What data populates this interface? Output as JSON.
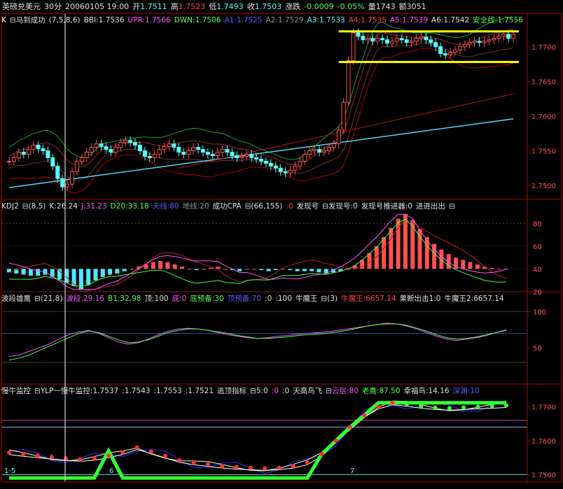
{
  "header": {
    "symbol": "英磅兑美元",
    "period": "30分",
    "datetime": "20060105 19:00",
    "open_label": "开",
    "open": "1.7511",
    "high_label": "高",
    "high": "1.7523",
    "low_label": "低",
    "low": "1.7493",
    "close_label": "收",
    "close": "1.7503",
    "change_label": "涨跌",
    "change": "-0.0009",
    "change_pct": "-0.05%",
    "volume_label": "量1743",
    "amount_label": "额3051"
  },
  "panel1": {
    "k": "K",
    "name": "马到成功",
    "params": "(7,5,8,6)",
    "bbi": "BBI:1.7536",
    "upr": "UPR:1.7566",
    "dwn": "DWN:1.7506",
    "a1": "A1:1.7525",
    "a2": "A2:1.7529",
    "a3": "A3:1.7533",
    "a4": "A4:1.7535",
    "a5": "A5:1.7539",
    "a6": "A6:1.7542",
    "safe": "安全线:1.7556",
    "ticks": [
      "1.7700",
      "1.7650",
      "1.7600",
      "1.7550",
      "1.7500"
    ]
  },
  "panel2": {
    "name": "KDJ2",
    "params": "(8,5)",
    "k": "K:26.24",
    "j": "J:31.23",
    "d20": "D20:33.18",
    "tian": "天线:80",
    "di": "地线:20",
    "cpa": "成功CPA",
    "cpa_params": "(66,155)",
    "zero": ":0",
    "faxian": "发现号",
    "faxian0": "发现号:0",
    "tuijin": "发现号推进器:0",
    "jinjin": "进进出出",
    "ticks": [
      "80",
      "60",
      "40",
      "20"
    ]
  },
  "panel3": {
    "name": "波段雄鹰",
    "params": "(21,8)",
    "boduan": "波段:29.16",
    "b1": "B1:32.98",
    "ding": "顶:100",
    "di": "底:0",
    "diyb": "底预备:30",
    "dingyb": "顶预备:70",
    "z": ":0",
    "h": ":100",
    "niu": "牛魔王",
    "p3": "(3)",
    "niu1": "牛魔王:6657.14",
    "guo": "果断出击1:0",
    "niu2": "牛魔王2:6657.14",
    "ticks": [
      "100",
      "50"
    ]
  },
  "panel4": {
    "name": "慢牛监控",
    "ylp": "YLP一慢牛监控:1.7537",
    "v2": ":1.7543",
    "v3": ":1.7553",
    "v4": ":1.7521",
    "taoding": "逃顶指标",
    "p": "5:0",
    "z1": ":0",
    "z2": ":0",
    "tiangao": "天高鸟飞",
    "yun": "云层:80",
    "laoying": "老鹰:87.50",
    "xingfu": "幸福鸟:14.16",
    "shenyuan": "深渊:10",
    "ticks": [
      "1.7700",
      "1.7600",
      "1.7500"
    ],
    "bottom_labels": [
      "1-5",
      "6",
      "7"
    ]
  },
  "colors": {
    "up": "#ff5454",
    "down": "#54ffff",
    "frame": "#b40000",
    "yellow": "#ffff00",
    "green": "#33ff33"
  },
  "chart_data": [
    {
      "type": "candlestick",
      "title": "马到成功(7,5,8,6)",
      "ylim": [
        1.748,
        1.773
      ],
      "yticks": [
        1.75,
        1.755,
        1.76,
        1.765,
        1.77
      ],
      "close_path": [
        1.7535,
        1.754,
        1.7548,
        1.7545,
        1.7552,
        1.7558,
        1.7553,
        1.755,
        1.754,
        1.7528,
        1.751,
        1.7498,
        1.7502,
        1.752,
        1.7535,
        1.754,
        1.7548,
        1.7555,
        1.756,
        1.7556,
        1.7552,
        1.7548,
        1.7555,
        1.7562,
        1.7565,
        1.7562,
        1.7558,
        1.755,
        1.7542,
        1.754,
        1.7545,
        1.7552,
        1.7556,
        1.756,
        1.7555,
        1.7548,
        1.7545,
        1.755,
        1.7555,
        1.7552,
        1.7548,
        1.7545,
        1.7543,
        1.7548,
        1.7552,
        1.7548,
        1.7543,
        1.754,
        1.7542,
        1.7545,
        1.754,
        1.7538,
        1.7535,
        1.7532,
        1.7528,
        1.7525,
        1.752,
        1.7518,
        1.7522,
        1.7528,
        1.7535,
        1.7545,
        1.755,
        1.7552,
        1.7548,
        1.755,
        1.7555,
        1.756,
        1.758,
        1.762,
        1.768,
        1.772,
        1.7715,
        1.771,
        1.7712,
        1.7708,
        1.7712,
        1.771,
        1.7705,
        1.7708,
        1.7712,
        1.771,
        1.7706,
        1.7708,
        1.7712,
        1.7714,
        1.771,
        1.7706,
        1.77,
        1.769,
        1.7688,
        1.7692,
        1.7695,
        1.77,
        1.7703,
        1.7706,
        1.7708,
        1.7706,
        1.7708,
        1.771,
        1.7712,
        1.7715,
        1.7718,
        1.7712,
        1.7718
      ],
      "horizontal_lines": [
        1.7722,
        1.7678
      ]
    },
    {
      "type": "bar",
      "title": "KDJ2(8,5)",
      "ylim": [
        20,
        90
      ],
      "yticks": [
        20,
        40,
        60,
        80
      ],
      "values": [
        37,
        36,
        35,
        34,
        34,
        35,
        33,
        31,
        28,
        25,
        22,
        26,
        30,
        33,
        35,
        36,
        38,
        40,
        42,
        44,
        46,
        47,
        46,
        44,
        42,
        40,
        39,
        40,
        41,
        42,
        40,
        39,
        38,
        40,
        40,
        39,
        38,
        39,
        40,
        39,
        38,
        38,
        38,
        37,
        36,
        37,
        38,
        40,
        43,
        48,
        54,
        60,
        68,
        76,
        84,
        88,
        83,
        75,
        68,
        62,
        57,
        53,
        50,
        48,
        46,
        44,
        42,
        41,
        40,
        40
      ]
    },
    {
      "type": "line",
      "title": "波段雄鹰(21,8)",
      "ylim": [
        0,
        110
      ],
      "yticks": [
        50,
        100
      ],
      "series": [
        {
          "name": "波段",
          "values": [
            38,
            40,
            45,
            50,
            55,
            62,
            68,
            72,
            74,
            70,
            64,
            58,
            55,
            57,
            62,
            68,
            73,
            76,
            77,
            76,
            74,
            71,
            68,
            66,
            64,
            63,
            64,
            66,
            67,
            69,
            70,
            71,
            72,
            74,
            76,
            78,
            80,
            82,
            84,
            83,
            80,
            76,
            71,
            66,
            62,
            60,
            62,
            64,
            67,
            71,
            75
          ]
        },
        {
          "name": "B1",
          "values": [
            33,
            36,
            40,
            46,
            52,
            58,
            64,
            70,
            73,
            71,
            66,
            61,
            57,
            58,
            61,
            66,
            71,
            74,
            76,
            76,
            74,
            72,
            70,
            67,
            65,
            63,
            63,
            64,
            65,
            67,
            68,
            69,
            70,
            72,
            74,
            77,
            80,
            82,
            83,
            83,
            81,
            77,
            73,
            68,
            64,
            62,
            63,
            65,
            68,
            71,
            74
          ]
        }
      ]
    },
    {
      "type": "line",
      "title": "慢牛监控",
      "ylim": [
        1.748,
        1.773
      ],
      "yticks": [
        1.75,
        1.76,
        1.77
      ],
      "series": [
        {
          "name": "YLP一慢牛监控",
          "values": [
            1.7565,
            1.756,
            1.7556,
            1.7552,
            1.7548,
            1.7545,
            1.7548,
            1.7556,
            1.7565,
            1.758,
            1.7568,
            1.7555,
            1.7542,
            1.7535,
            1.753,
            1.7525,
            1.7522,
            1.752,
            1.7518,
            1.752,
            1.7525,
            1.7535,
            1.756,
            1.76,
            1.764,
            1.7675,
            1.77,
            1.7712,
            1.7708,
            1.7702,
            1.7698,
            1.7696,
            1.7698,
            1.77,
            1.7702,
            1.7704
          ]
        }
      ]
    }
  ]
}
